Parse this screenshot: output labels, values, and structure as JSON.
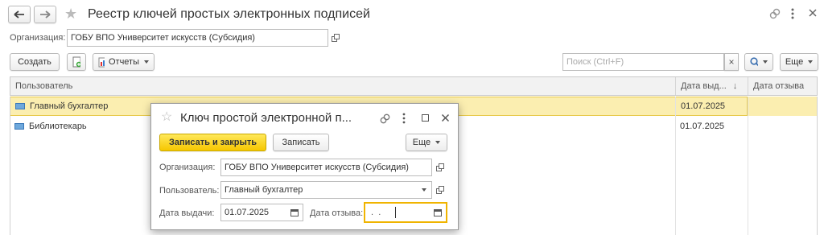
{
  "window": {
    "title": "Реестр ключей простых электронных подписей",
    "organization_label": "Организация:",
    "organization_value": "ГОБУ ВПО Университет искусств (Субсидия)"
  },
  "toolbar": {
    "create_label": "Создать",
    "reports_label": "Отчеты",
    "search_placeholder": "Поиск (Ctrl+F)",
    "clear_label": "×",
    "more_label": "Еще"
  },
  "table": {
    "columns": [
      "Пользователь",
      "Дата выд...",
      "Дата отзыва"
    ],
    "sort_indicator": "↓",
    "rows": [
      {
        "user": "Главный бухгалтер",
        "issued": "01.07.2025",
        "revoked": ""
      },
      {
        "user": "Библиотекарь",
        "issued": "01.07.2025",
        "revoked": ""
      }
    ]
  },
  "dialog": {
    "title": "Ключ простой электронной п...",
    "save_close_label": "Записать и закрыть",
    "save_label": "Записать",
    "more_label": "Еще",
    "org_label": "Организация:",
    "org_value": "ГОБУ ВПО Университет искусств (Субсидия)",
    "user_label": "Пользователь:",
    "user_value": "Главный бухгалтер",
    "issue_date_label": "Дата выдачи:",
    "issue_date_value": "01.07.2025",
    "revoke_date_label": "Дата отзыва:",
    "revoke_date_value": " .  .     "
  },
  "colors": {
    "selected_row": "#fbeeb0",
    "accent_yellow": "#f6c700",
    "focus_border": "#f0b400"
  }
}
